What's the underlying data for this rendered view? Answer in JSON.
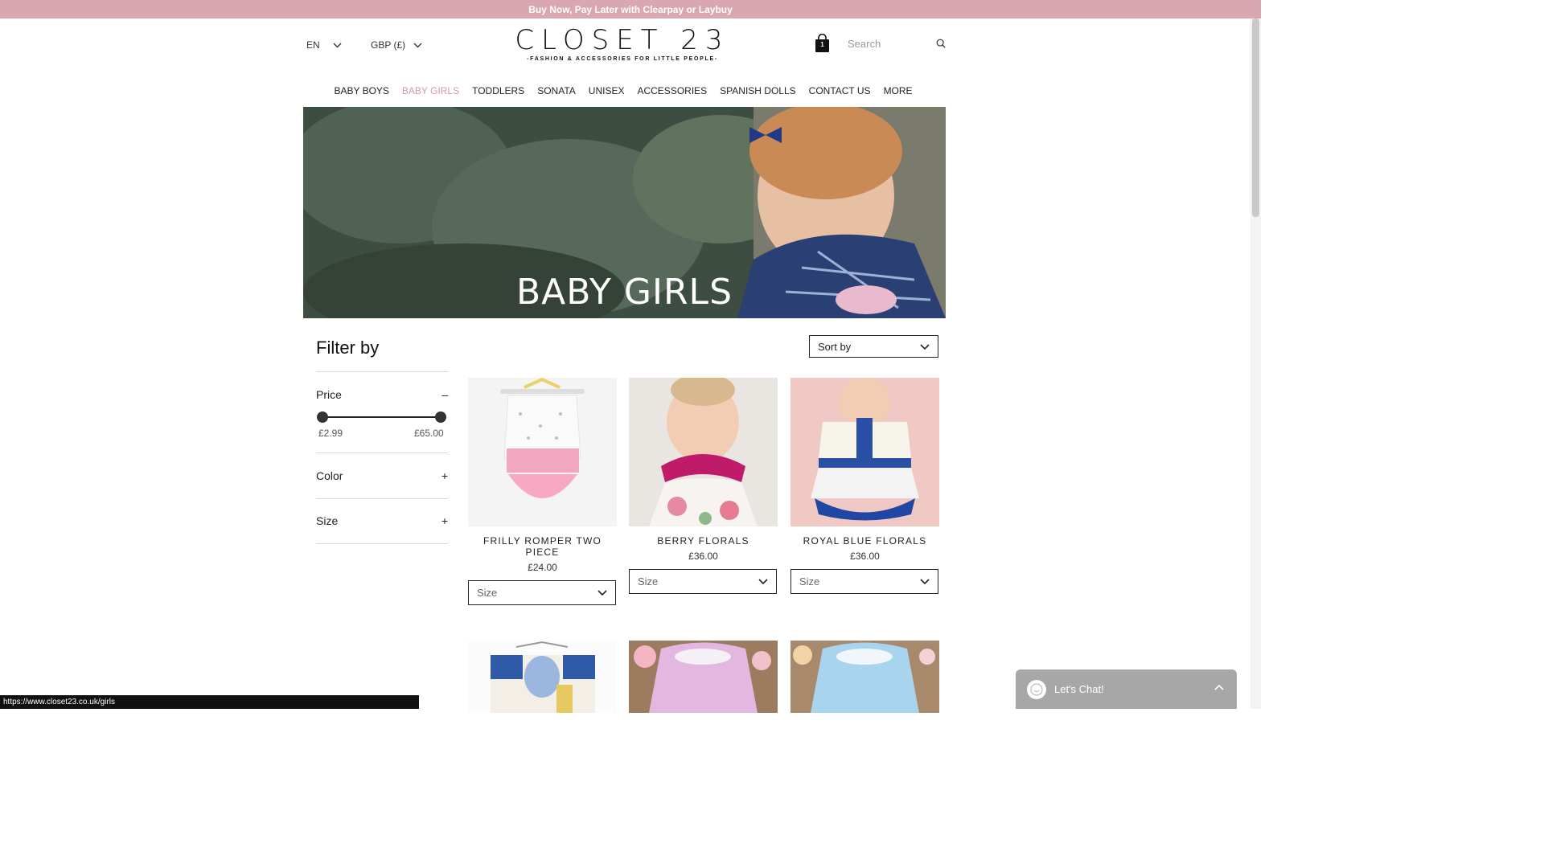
{
  "topbar": {
    "promo_text": "Buy Now, Pay Later with Clearpay or Laybuy"
  },
  "header": {
    "language": "EN",
    "currency": "GBP (£)",
    "logo_title": "CLOSET 23",
    "logo_tagline": "-FASHION & ACCESSORIES FOR LITTLE PEOPLE-",
    "cart_count": "1",
    "search_placeholder": "Search"
  },
  "nav": {
    "items": [
      {
        "label": "BABY BOYS"
      },
      {
        "label": "BABY GIRLS"
      },
      {
        "label": "TODDLERS"
      },
      {
        "label": "SONATA"
      },
      {
        "label": "UNISEX"
      },
      {
        "label": "ACCESSORIES"
      },
      {
        "label": "SPANISH DOLLS"
      },
      {
        "label": "CONTACT US"
      },
      {
        "label": "MORE"
      }
    ],
    "active_index": 1,
    "active_color": "#d49aa6"
  },
  "hero": {
    "title": "BABY  GIRLS"
  },
  "filters": {
    "title": "Filter by",
    "price_label": "Price",
    "price_toggle": "–",
    "price_min": "£2.99",
    "price_max": "£65.00",
    "color_label": "Color",
    "color_toggle": "+",
    "size_label": "Size",
    "size_toggle": "+"
  },
  "sort": {
    "label": "Sort by"
  },
  "products": [
    {
      "name": "FRILLY ROMPER TWO PIECE",
      "price": "£24.00",
      "size_placeholder": "Size"
    },
    {
      "name": "BERRY FLORALS",
      "price": "£36.00",
      "size_placeholder": "Size"
    },
    {
      "name": "ROYAL BLUE FLORALS",
      "price": "£36.00",
      "size_placeholder": "Size"
    }
  ],
  "status_bar": {
    "url": "https://www.closet23.co.uk/girls"
  },
  "chat": {
    "label": "Let's Chat!"
  },
  "colors": {
    "topbar": "#d9a7b0",
    "accent": "#d49aa6",
    "chat": "#a7a7a7"
  }
}
